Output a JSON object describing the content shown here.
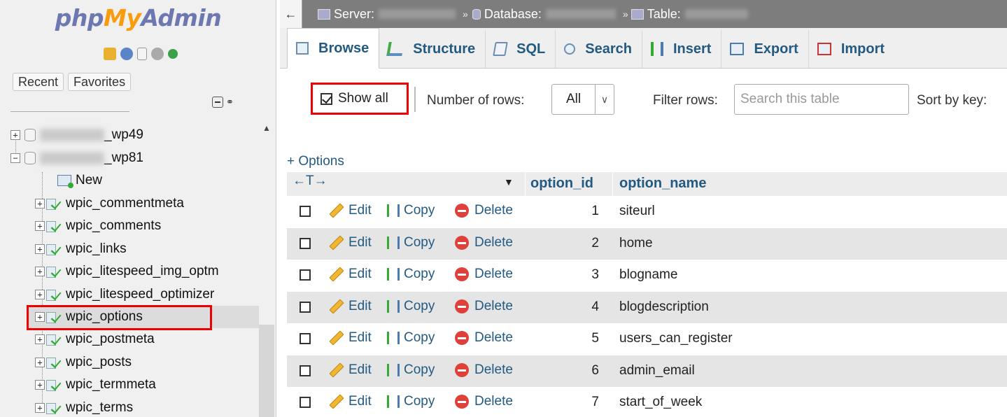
{
  "sidebar": {
    "logo": {
      "php": "php",
      "my": "My",
      "admin": "Admin"
    },
    "quick_icons": [
      "home-icon",
      "logout-icon",
      "docs-icon",
      "settings-icon",
      "reload-icon"
    ],
    "recent_label": "Recent",
    "favorites_label": "Favorites",
    "tree": {
      "db1_suffix": "_wp49",
      "db2_suffix": "_wp81",
      "new_label": "New",
      "tables": [
        "wpic_commentmeta",
        "wpic_comments",
        "wpic_links",
        "wpic_litespeed_img_optm",
        "wpic_litespeed_optimizer",
        "wpic_options",
        "wpic_postmeta",
        "wpic_posts",
        "wpic_termmeta",
        "wpic_terms"
      ],
      "selected": "wpic_options"
    }
  },
  "topbar": {
    "server_label": "Server:",
    "database_label": "Database:",
    "table_label": "Table:"
  },
  "menu": {
    "tabs": [
      "Browse",
      "Structure",
      "SQL",
      "Search",
      "Insert",
      "Export",
      "Import"
    ],
    "active": "Browse"
  },
  "controls": {
    "show_all_label": "Show all",
    "show_all_checked": true,
    "rows_label": "Number of rows:",
    "rows_value": "All",
    "filter_label": "Filter rows:",
    "filter_placeholder": "Search this table",
    "sort_label": "Sort by key:"
  },
  "table": {
    "options_link": "+ Options",
    "column_nav_arrows": "←T→",
    "columns": [
      "option_id",
      "option_name"
    ],
    "actions": {
      "edit": "Edit",
      "copy": "Copy",
      "delete": "Delete"
    },
    "rows": [
      {
        "id": "1",
        "name": "siteurl"
      },
      {
        "id": "2",
        "name": "home"
      },
      {
        "id": "3",
        "name": "blogname"
      },
      {
        "id": "4",
        "name": "blogdescription"
      },
      {
        "id": "5",
        "name": "users_can_register"
      },
      {
        "id": "6",
        "name": "admin_email"
      },
      {
        "id": "7",
        "name": "start_of_week"
      }
    ]
  }
}
